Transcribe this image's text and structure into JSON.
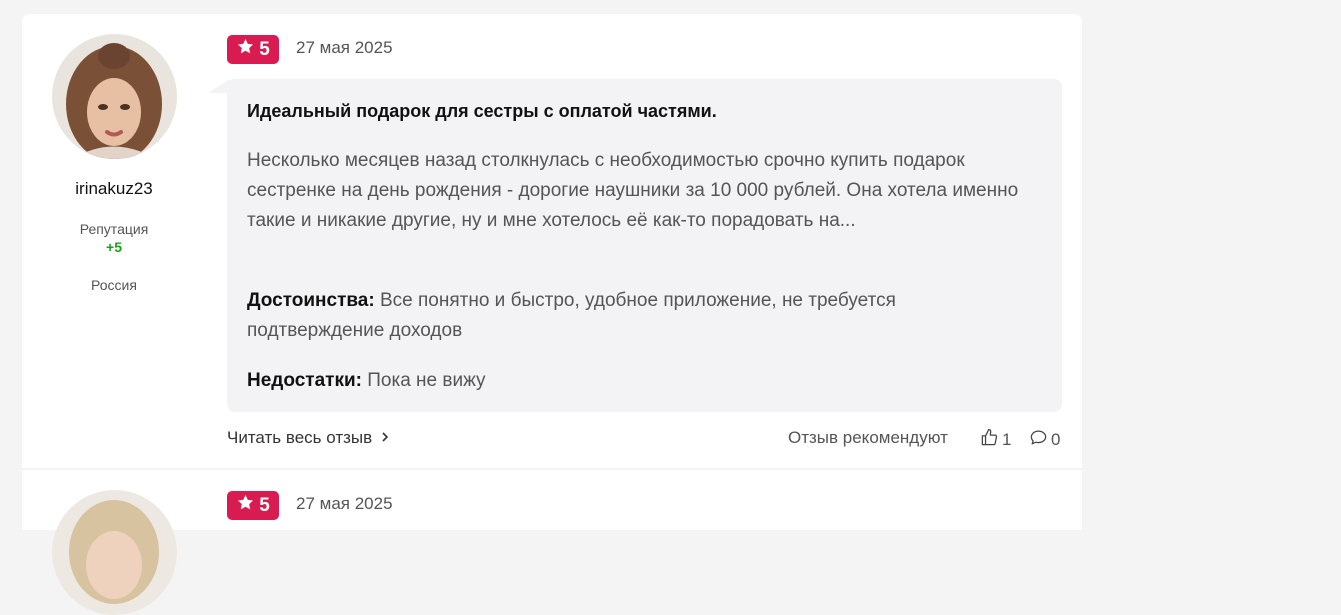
{
  "review1": {
    "username": "irinakuz23",
    "reputation_label": "Репутация",
    "reputation_value": "+5",
    "country": "Россия",
    "rating": "5",
    "date": "27 мая 2025",
    "title": "Идеальный подарок для сестры с оплатой частями.",
    "body": "Несколько месяцев назад столкнулась с необходимостью срочно купить подарок сестренке на день рождения - дорогие наушники за 10 000 рублей. Она хотела именно такие и никакие другие, ну и мне хотелось её как-то порадовать на...",
    "pros_label": "Достоинства:",
    "pros_text": "Все понятно и быстро, удобное приложение, не требуется подтверждение доходов",
    "cons_label": "Недостатки:",
    "cons_text": "Пока не вижу",
    "read_more": "Читать весь отзыв",
    "recommend_label": "Отзыв рекомендуют",
    "likes": "1",
    "comments": "0"
  },
  "review2": {
    "rating": "5",
    "date": "27 мая 2025"
  },
  "colors": {
    "rating_badge": "#d81b50",
    "reputation_positive": "#1aa31a"
  },
  "icons": {
    "rating": "star-icon",
    "read_more": "chevron-right-icon",
    "likes": "thumbs-up-icon",
    "comments": "comment-icon"
  }
}
